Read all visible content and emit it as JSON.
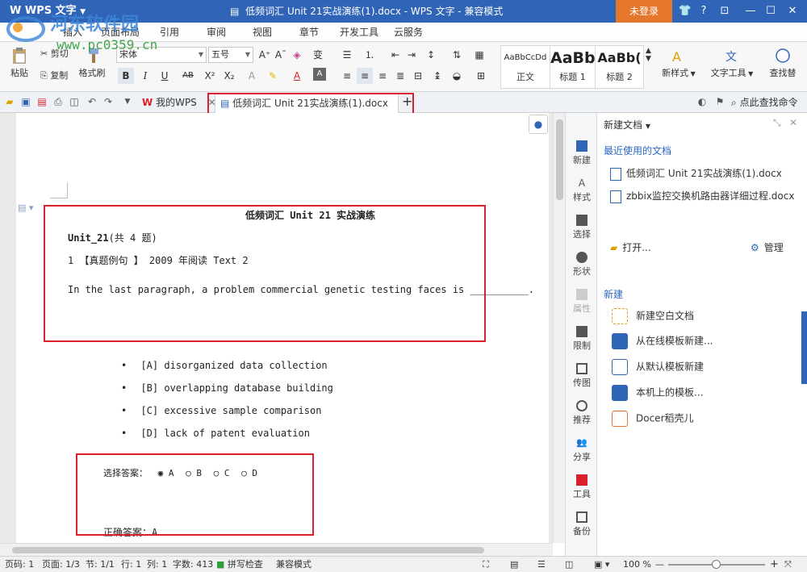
{
  "titlebar": {
    "app_name": "WPS 文字",
    "title": "低频词汇 Unit 21实战演练(1).docx - WPS 文字 - 兼容模式",
    "login": "未登录",
    "help": "?"
  },
  "menu": {
    "tabs": [
      "插入",
      "页面布局",
      "引用",
      "审阅",
      "视图",
      "章节",
      "开发工具",
      "云服务"
    ]
  },
  "ribbon": {
    "paste": "粘贴",
    "cut": "剪切",
    "copy": "复制",
    "format_painter": "格式刷",
    "font_name": "宋体",
    "font_size": "五号",
    "styles": [
      {
        "sample": "AaBbCcDd",
        "label": "正文"
      },
      {
        "sample": "AaBb",
        "label": "标题 1"
      },
      {
        "sample": "AaBb(",
        "label": "标题 2"
      }
    ],
    "new_style": "新样式",
    "text_tools": "文字工具",
    "find_replace": "查找替"
  },
  "tabs": {
    "wps_home": "我的WPS",
    "doc_tab": "低频词汇 Unit 21实战演练(1).docx",
    "search_cmd": "点此查找命令"
  },
  "document": {
    "title": "低频词汇 Unit 21 实战演练",
    "unit_bold": "Unit_21",
    "unit_rest": "(共 4 题)",
    "question_head": "1 【真题例句 】 2009 年阅读 Text 2",
    "question": "In the last paragraph, a problem commercial genetic testing faces is __________.",
    "options": [
      "[A] disorganized data collection",
      "[B] overlapping database building",
      "[C] excessive sample comparison",
      "[D] lack of patent evaluation"
    ],
    "answer_label": "选择答案：",
    "answer_choices": [
      "A",
      "B",
      "C",
      "D"
    ],
    "answer_selected": "A",
    "correct_answer": "正确答案：A"
  },
  "sidebar": {
    "items": [
      "新建",
      "样式",
      "选择",
      "形状",
      "属性",
      "限制",
      "传图",
      "推荐",
      "分享",
      "工具",
      "备份"
    ]
  },
  "taskpane": {
    "title": "新建文档",
    "recent_heading": "最近使用的文档",
    "recent_docs": [
      "低频词汇 Unit 21实战演练(1).docx",
      "zbbix监控交换机路由器详细过程.docx"
    ],
    "open": "打开...",
    "manage": "管理",
    "new_heading": "新建",
    "new_items": [
      "新建空白文档",
      "从在线模板新建...",
      "从默认模板新建",
      "本机上的模板...",
      "Docer稻壳儿"
    ]
  },
  "statusbar": {
    "page_num": "页码: 1",
    "pages": "页面: 1/3",
    "section": "节: 1/1",
    "row": "行: 1",
    "col": "列: 1",
    "words": "字数: 413",
    "spell": "拼写检查",
    "compat": "兼容模式",
    "zoom": "100 %"
  },
  "watermark": {
    "site_name": "河东软件园",
    "url": "www.pc0359.cn"
  },
  "colors": {
    "title_blue": "#2f64b7",
    "login_orange": "#e5772c",
    "highlight_red": "#d9202c",
    "link_blue": "#2b68c2"
  }
}
